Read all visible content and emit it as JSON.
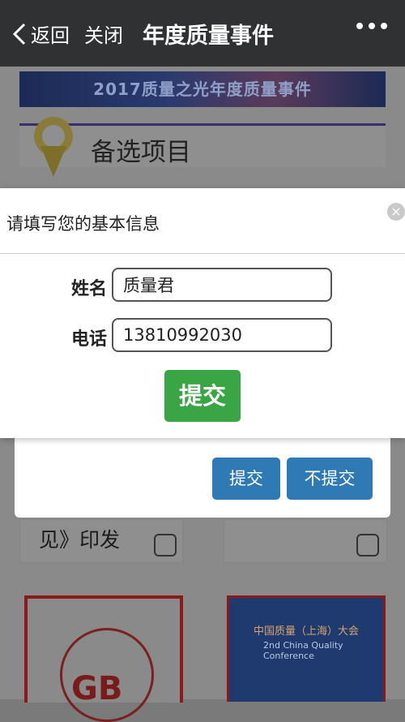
{
  "nav": {
    "back_label": "返回",
    "close_label": "关闭",
    "title": "年度质量事件"
  },
  "background": {
    "banner_text": "2017质量之光年度质量事件",
    "section_title": "备选项目",
    "item_fragment": "见》印发",
    "poster2_line1": "中国质量（上海）大会",
    "poster2_line2": "2nd China Quality Conference",
    "poster1_text": "GB"
  },
  "back_modal": {
    "submit_label": "提交",
    "no_submit_label": "不提交"
  },
  "dialog": {
    "title": "请填写您的基本信息",
    "close_glyph": "×",
    "name_label": "姓名",
    "name_value": "质量君",
    "phone_label": "电话",
    "phone_value": "13810992030",
    "submit_label": "提交"
  }
}
